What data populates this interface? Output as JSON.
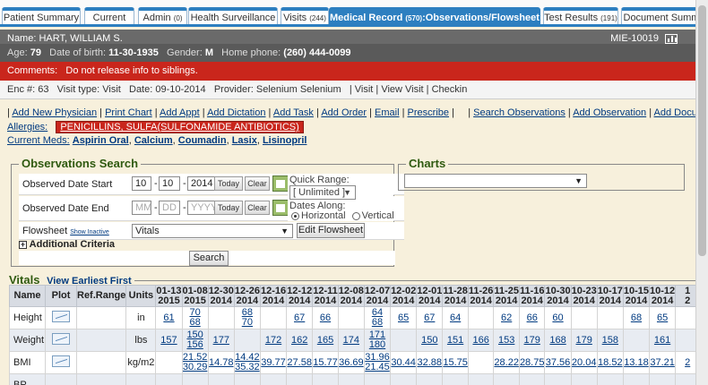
{
  "tabs": [
    {
      "label": "Patient Summary",
      "count": ""
    },
    {
      "label": "Current",
      "count": ""
    },
    {
      "label": "Admin",
      "count": "(0)"
    },
    {
      "label": "Health Surveillance",
      "count": ""
    },
    {
      "label": "Visits",
      "count": "(244)"
    },
    {
      "label": "Medical Record",
      "count": "(570)",
      "suffix": ":Observations/Flowsheets",
      "suffix_count": "(518)"
    },
    {
      "label": "Test Results",
      "count": "(191)"
    },
    {
      "label": "Document Summ",
      "count": ""
    }
  ],
  "patient": {
    "name_label": "Name:",
    "name": "HART, WILLIAM S.",
    "mie": "MIE-10019",
    "age_label": "Age:",
    "age": "79",
    "dob_label": "Date of birth:",
    "dob": "11-30-1935",
    "gender_label": "Gender:",
    "gender": "M",
    "phone_label": "Home phone:",
    "phone": "(260) 444-0099",
    "comments_label": "Comments:",
    "comments": "Do not release info to siblings."
  },
  "encounter": {
    "enc_label": "Enc #:",
    "enc": "63",
    "type_label": "Visit type:",
    "type": "Visit",
    "date_label": "Date:",
    "date": "09-10-2014",
    "provider_label": "Provider:",
    "provider": "Selenium Selenium",
    "links": "| Visit | View Visit | Checkin"
  },
  "actions": [
    "Add New Physician",
    "Print Chart",
    "Add Appt",
    "Add Dictation",
    "Add Task",
    "Add Order",
    "Email",
    "Prescribe",
    "Search Observations",
    "Add Observation",
    "Add Document"
  ],
  "allergies": {
    "label": "Allergies:",
    "value": "PENICILLINS, SULFA(SULFONAMIDE ANTIBIOTICS)"
  },
  "meds": {
    "label": "Current Meds:",
    "items": [
      "Aspirin Oral",
      "Calcium",
      "Coumadin",
      "Lasix",
      "Lisinopril"
    ]
  },
  "obs_search": {
    "legend": "Observations Search",
    "start_label": "Observed Date Start",
    "start_mm": "10",
    "start_dd": "10",
    "start_yyyy": "2014",
    "end_label": "Observed Date End",
    "end_mm_ph": "MM",
    "end_dd_ph": "DD",
    "end_yyyy_ph": "YYYY",
    "today": "Today",
    "clear": "Clear",
    "quick_range_label": "Quick Range:",
    "quick_range_value": "[ Unlimited ]",
    "dates_along_label": "Dates Along:",
    "horizontal": "Horizontal",
    "vertical": "Vertical",
    "flowsheet_label": "Flowsheet",
    "show_inactive": "Show Inactive",
    "flowsheet_value": "Vitals",
    "edit_flowsheet": "Edit Flowsheet",
    "additional_criteria": "Additional Criteria",
    "search": "Search"
  },
  "charts": {
    "legend": "Charts"
  },
  "vitals": {
    "title": "Vitals",
    "earliest_first": "View Earliest First",
    "headers": [
      "Name",
      "Plot",
      "Ref.Range",
      "Units"
    ],
    "dates": [
      [
        "01-13",
        "2015"
      ],
      [
        "01-08",
        "2015"
      ],
      [
        "12-30",
        "2014"
      ],
      [
        "12-26",
        "2014"
      ],
      [
        "12-16",
        "2014"
      ],
      [
        "12-12",
        "2014"
      ],
      [
        "12-11",
        "2014"
      ],
      [
        "12-08",
        "2014"
      ],
      [
        "12-07",
        "2014"
      ],
      [
        "12-02",
        "2014"
      ],
      [
        "12-01",
        "2014"
      ],
      [
        "11-28",
        "2014"
      ],
      [
        "11-26",
        "2014"
      ],
      [
        "11-25",
        "2014"
      ],
      [
        "11-16",
        "2014"
      ],
      [
        "10-30",
        "2014"
      ],
      [
        "10-23",
        "2014"
      ],
      [
        "10-17",
        "2014"
      ],
      [
        "10-15",
        "2014"
      ],
      [
        "10-12",
        "2014"
      ],
      [
        "1",
        "2"
      ]
    ],
    "rows": [
      {
        "name": "Height",
        "units": "in",
        "values": [
          [
            "61"
          ],
          [
            "70",
            "68"
          ],
          [
            ""
          ],
          [
            "68",
            "70"
          ],
          [
            ""
          ],
          [
            "67"
          ],
          [
            "66"
          ],
          [
            ""
          ],
          [
            "64",
            "68"
          ],
          [
            "65"
          ],
          [
            "67"
          ],
          [
            "64"
          ],
          [
            ""
          ],
          [
            "62"
          ],
          [
            "66"
          ],
          [
            "60"
          ],
          [
            ""
          ],
          [
            ""
          ],
          [
            "68"
          ],
          [
            "65"
          ],
          [
            ""
          ]
        ]
      },
      {
        "name": "Weight",
        "units": "lbs",
        "values": [
          [
            "157"
          ],
          [
            "150",
            "156"
          ],
          [
            "177"
          ],
          [
            ""
          ],
          [
            "172"
          ],
          [
            "162"
          ],
          [
            "165"
          ],
          [
            "174"
          ],
          [
            "171",
            "180"
          ],
          [
            ""
          ],
          [
            "150"
          ],
          [
            "151"
          ],
          [
            "166"
          ],
          [
            "153"
          ],
          [
            "179"
          ],
          [
            "168"
          ],
          [
            "179"
          ],
          [
            "158"
          ],
          [
            ""
          ],
          [
            "161"
          ],
          [
            ""
          ]
        ]
      },
      {
        "name": "BMI",
        "units": "kg/m2",
        "values": [
          [
            ""
          ],
          [
            "21.52",
            "30.29"
          ],
          [
            "14.78"
          ],
          [
            "14.42",
            "35.32"
          ],
          [
            "39.77"
          ],
          [
            "27.58"
          ],
          [
            "15.77"
          ],
          [
            "36.69"
          ],
          [
            "31.96",
            "21.45"
          ],
          [
            "30.44"
          ],
          [
            "32.88"
          ],
          [
            "15.75"
          ],
          [
            ""
          ],
          [
            "28.22"
          ],
          [
            "28.75"
          ],
          [
            "37.56"
          ],
          [
            "20.04"
          ],
          [
            "18.52"
          ],
          [
            "13.18"
          ],
          [
            "37.21"
          ],
          [
            "2"
          ]
        ]
      },
      {
        "name": "BP",
        "units": "",
        "values": []
      }
    ]
  }
}
